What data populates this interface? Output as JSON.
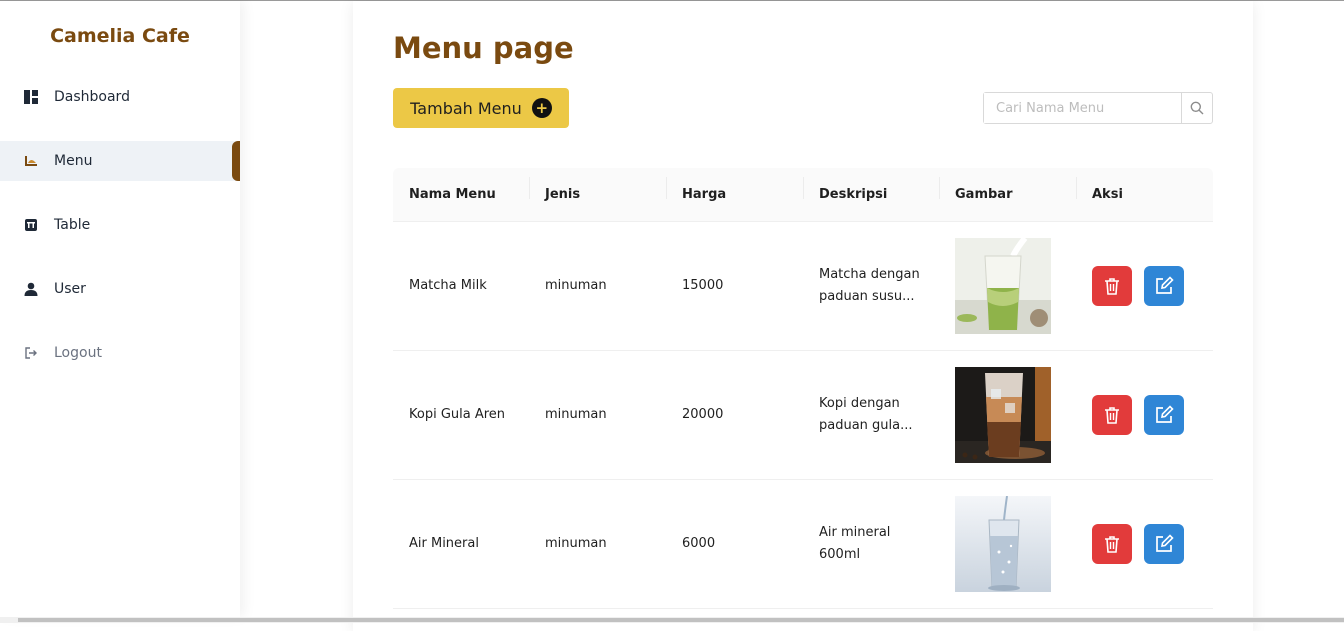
{
  "sidebar": {
    "brand": "Camelia Cafe",
    "items": [
      {
        "label": "Dashboard",
        "icon": "dashboard-icon"
      },
      {
        "label": "Menu",
        "icon": "food-icon",
        "active": true
      },
      {
        "label": "Table",
        "icon": "table-icon"
      },
      {
        "label": "User",
        "icon": "user-icon"
      },
      {
        "label": "Logout",
        "icon": "logout-icon"
      }
    ]
  },
  "main": {
    "title": "Menu page",
    "add_button_label": "Tambah Menu",
    "search": {
      "placeholder": "Cari Nama Menu",
      "value": ""
    },
    "table": {
      "headers": [
        "Nama Menu",
        "Jenis",
        "Harga",
        "Deskripsi",
        "Gambar",
        "Aksi"
      ],
      "rows": [
        {
          "nama": "Matcha Milk",
          "jenis": "minuman",
          "harga": "15000",
          "deskripsi_1": "Matcha dengan",
          "deskripsi_2": "paduan susu..."
        },
        {
          "nama": "Kopi Gula Aren",
          "jenis": "minuman",
          "harga": "20000",
          "deskripsi_1": "Kopi dengan",
          "deskripsi_2": "paduan gula..."
        },
        {
          "nama": "Air Mineral",
          "jenis": "minuman",
          "harga": "6000",
          "deskripsi_1": "Air mineral",
          "deskripsi_2": "600ml"
        }
      ]
    }
  },
  "colors": {
    "brand": "#7a4a10",
    "add_button": "#ecc846",
    "delete_button": "#e23b3b",
    "edit_button": "#2f86d6"
  }
}
